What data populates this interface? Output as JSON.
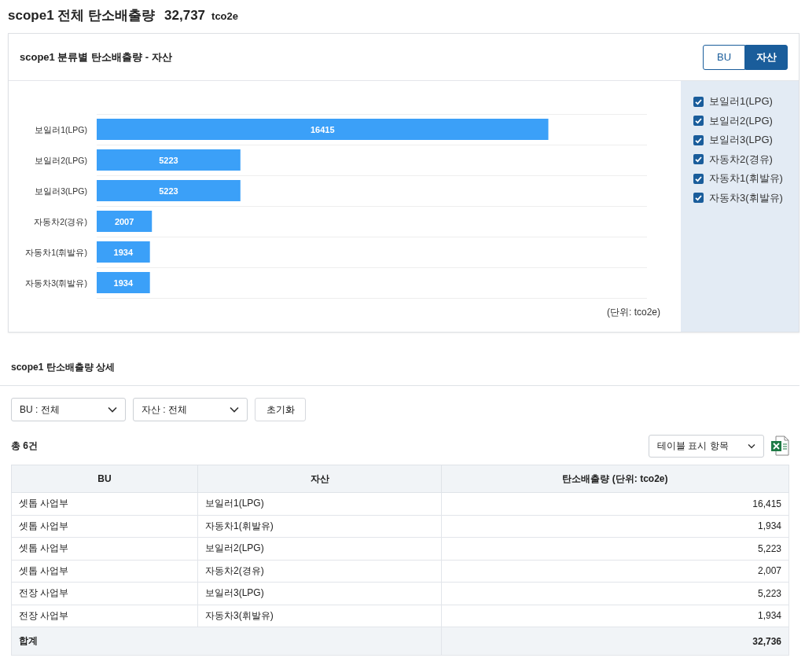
{
  "page_title": {
    "label": "scope1 전체 탄소배출량",
    "total": "32,737",
    "unit": "tco2e"
  },
  "chart_card": {
    "title": "scope1 분류별 탄소배출량 - 자산",
    "toggle": [
      {
        "label": "BU",
        "selected": false
      },
      {
        "label": "자산",
        "selected": true
      }
    ],
    "chart_data": {
      "type": "bar",
      "orientation": "horizontal",
      "categories": [
        "보일러1(LPG)",
        "보일러2(LPG)",
        "보일러3(LPG)",
        "자동차2(경유)",
        "자동차1(휘발유)",
        "자동차3(휘발유)"
      ],
      "series": [
        {
          "color": "#3ba0f8",
          "values": [
            16415,
            5223,
            5223,
            2007,
            1934,
            1934
          ]
        }
      ],
      "xlim": [
        0,
        20000
      ],
      "data_labels": true
    },
    "unit_note": "(단위: tco2e)",
    "legend": [
      {
        "label": "보일러1(LPG)",
        "checked": true
      },
      {
        "label": "보일러2(LPG)",
        "checked": true
      },
      {
        "label": "보일러3(LPG)",
        "checked": true
      },
      {
        "label": "자동차2(경유)",
        "checked": true
      },
      {
        "label": "자동차1(휘발유)",
        "checked": true
      },
      {
        "label": "자동차3(휘발유)",
        "checked": true
      }
    ]
  },
  "detail": {
    "title": "scope1 탄소배출량 상세",
    "filters": [
      {
        "value": "BU : 전체"
      },
      {
        "value": "자산 : 전체"
      }
    ],
    "reset_button": "초기화",
    "count": "총 6건",
    "columns_dropdown": "테이블 표시 항목",
    "table": {
      "columns": [
        "BU",
        "자산",
        "탄소배출량 (단위: tco2e)"
      ],
      "rows": [
        [
          "셋톱 사업부",
          "보일러1(LPG)",
          "16,415"
        ],
        [
          "셋톱 사업부",
          "자동차1(휘발유)",
          "1,934"
        ],
        [
          "셋톱 사업부",
          "보일러2(LPG)",
          "5,223"
        ],
        [
          "셋톱 사업부",
          "자동차2(경유)",
          "2,007"
        ],
        [
          "전장 사업부",
          "보일러3(LPG)",
          "5,223"
        ],
        [
          "전장 사업부",
          "자동차3(휘발유)",
          "1,934"
        ]
      ],
      "total_row": {
        "label": "합계",
        "value": "32,736"
      }
    }
  }
}
